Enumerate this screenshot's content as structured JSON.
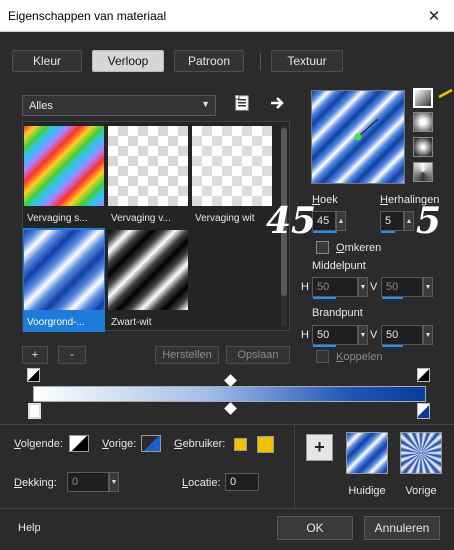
{
  "window": {
    "title": "Eigenschappen van materiaal",
    "close_glyph": "✕"
  },
  "tabs": [
    {
      "label": "Kleur",
      "active": false
    },
    {
      "label": "Verloop",
      "active": true
    },
    {
      "label": "Patroon",
      "active": false
    },
    {
      "label": "Textuur",
      "active": false
    }
  ],
  "category": {
    "selected": "Alles"
  },
  "gallery": {
    "items": [
      {
        "label": "Vervaging s...",
        "selected": false
      },
      {
        "label": "Vervaging v...",
        "selected": false
      },
      {
        "label": "Vervaging wit",
        "selected": false
      },
      {
        "label": "Voorgrond-...",
        "selected": true
      },
      {
        "label": "Zwart-wit",
        "selected": false
      }
    ]
  },
  "gallery_buttons": {
    "add": "+",
    "remove": "-",
    "restore": "Herstellen",
    "save": "Opslaan"
  },
  "angle": {
    "label": "Hoek",
    "value": "45",
    "overlay": "45"
  },
  "repeats": {
    "label": "Herhalingen",
    "value": "5",
    "overlay": "5"
  },
  "invert": {
    "label": "Omkeren",
    "checked": false
  },
  "midpoint": {
    "label": "Middelpunt",
    "h_label": "H",
    "h_value": "50",
    "v_label": "V",
    "v_value": "50"
  },
  "focal": {
    "label": "Brandpunt",
    "h_label": "H",
    "h_value": "50",
    "v_label": "V",
    "v_value": "50"
  },
  "link": {
    "label": "Koppelen",
    "checked": false
  },
  "stops": {
    "next_label": "Volgende:",
    "prev_label": "Vorige:",
    "user_label": "Gebruiker:",
    "opacity_label": "Dekking:",
    "opacity_value": "0",
    "location_label": "Locatie:",
    "location_value": "0"
  },
  "previews": {
    "current_label": "Huidige",
    "previous_label": "Vorige"
  },
  "footer": {
    "help": "Help",
    "ok": "OK",
    "cancel": "Annuleren"
  },
  "colors": {
    "gradient_start": "#ffffff",
    "gradient_end": "#0a3a9a",
    "selection": "#1e7cd8",
    "user_color": "#f2c200",
    "background": "#2b2b2b"
  }
}
